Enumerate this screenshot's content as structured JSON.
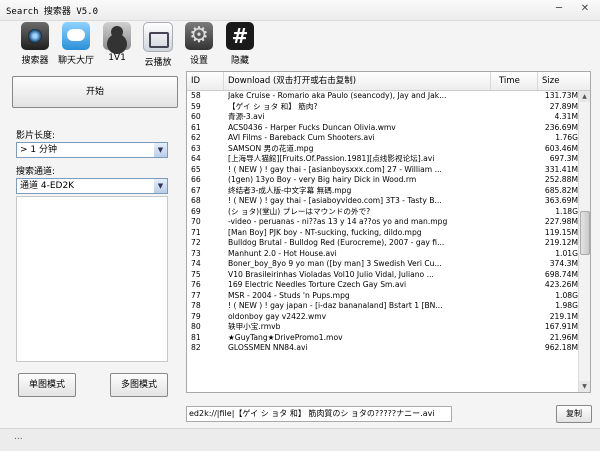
{
  "window": {
    "title": "Search 搜索器 V5.0",
    "min": "─",
    "close": "✕"
  },
  "toolbar": [
    {
      "label": "搜索器",
      "icon": "camera-icon"
    },
    {
      "label": "聊天大厅",
      "icon": "chat-icon"
    },
    {
      "label": "1V1",
      "icon": "user-icon"
    },
    {
      "label": "云播放",
      "icon": "cloud-play-icon"
    },
    {
      "label": "设置",
      "icon": "gear-icon"
    },
    {
      "label": "隐藏",
      "icon": "hash-icon"
    }
  ],
  "left": {
    "start_label": "开始",
    "length_label": "影片长度:",
    "length_value": "> 1 分钟",
    "channel_label": "搜索通道:",
    "channel_value": "通道 4-ED2K",
    "single_mode": "单图模式",
    "multi_mode": "多图模式"
  },
  "table": {
    "headers": {
      "id": "ID",
      "download": "Download (双击打开或右击复制)",
      "time": "Time",
      "size": "Size"
    },
    "rows": [
      {
        "id": "58",
        "download": "Jake Cruise - Romario aka Paulo (seancody), Jay and Jak...",
        "size": "131.73M"
      },
      {
        "id": "59",
        "download": "【ゲイ シ ョタ 和】 筋肉?",
        "size": "27.89M"
      },
      {
        "id": "60",
        "download": "青源-3.avi",
        "size": "4.31M"
      },
      {
        "id": "61",
        "download": "ACS0436 - Harper Fucks Duncan   Olivia.wmv",
        "size": "236.69M"
      },
      {
        "id": "62",
        "download": "AVI Films - Bareback Cum Shooters.avi",
        "size": "1.76G"
      },
      {
        "id": "63",
        "download": "SAMSON 男の花道.mpg",
        "size": "603.46M"
      },
      {
        "id": "64",
        "download": "[上海导人猫館][Fruits.Of.Passion.1981][点线影视论坛].avi",
        "size": "697.3M"
      },
      {
        "id": "65",
        "download": "! ( NEW ) ! gay thai - [asianboysxxx.com] 27 - William ...",
        "size": "331.41M"
      },
      {
        "id": "66",
        "download": "(1gen) 13yo Boy - very Big hairy Dick in Wood.rm",
        "size": "252.88M"
      },
      {
        "id": "67",
        "download": "终结者3-成人版-中文字幕 無碼.mpg",
        "size": "685.82M"
      },
      {
        "id": "68",
        "download": "! ( NEW ) ! gay thai - [asiaboyvideo.com] 3T3 - Tasty B...",
        "size": "363.69M"
      },
      {
        "id": "69",
        "download": "(シ ョタ)(堂山) プレーはマウンドの外で?",
        "size": "1.18G"
      },
      {
        "id": "70",
        "download": "-video - peruanas - ni??as 13 y 14 a??os yo and man.mpg",
        "size": "227.98M"
      },
      {
        "id": "71",
        "download": "[Man Boy] PJK boy - NT-sucking, fucking, dildo.mpg",
        "size": "119.15M"
      },
      {
        "id": "72",
        "download": "Bulldog Brutal - Bulldog Red (Eurocreme), 2007 - gay fi...",
        "size": "219.12M"
      },
      {
        "id": "73",
        "download": "Manhunt 2.0 - Hot House.avi",
        "size": "1.01G"
      },
      {
        "id": "74",
        "download": "Boner_boy_8yo   9 yo   man ([by man] 3 Swedish Veri Cu...",
        "size": "374.3M"
      },
      {
        "id": "75",
        "download": "V10 Brasileirinhas Violadas Vol10 Julio Vidal, Juliano ...",
        "size": "698.74M"
      },
      {
        "id": "76",
        "download": "169 Electric Needles Torture Czech Gay Sm.avi",
        "size": "423.26M"
      },
      {
        "id": "77",
        "download": "MSR - 2004 - Studs 'n Pups.mpg",
        "size": "1.08G"
      },
      {
        "id": "78",
        "download": "! ( NEW ) ! gay japan - [i-daz bananaland] Bstart 1 [BN...",
        "size": "1.98G"
      },
      {
        "id": "79",
        "download": "oldonboy gay v2422.wmv",
        "size": "219.1M"
      },
      {
        "id": "80",
        "download": "轶甲小宝.rmvb",
        "size": "167.91M"
      },
      {
        "id": "81",
        "download": "★GuyTang★DrivePromo1.mov",
        "size": "21.96M"
      },
      {
        "id": "82",
        "download": "GLOSSMEN NN84.avi",
        "size": "962.18M"
      }
    ]
  },
  "status": {
    "link_value": "ed2k://|file|【ゲイ シ ョタ 和】 筋肉質のシ ョタの?????ナニー.avi",
    "copy_label": "复制",
    "dots": "..."
  }
}
